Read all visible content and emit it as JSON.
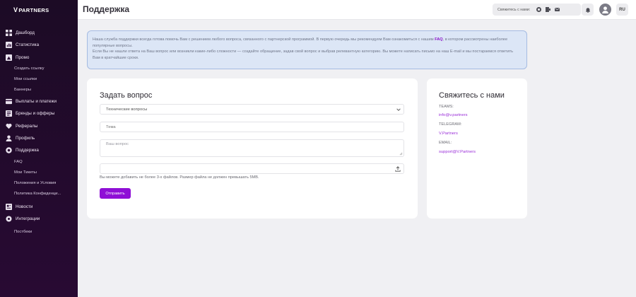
{
  "brand": {
    "logo_mark": "V",
    "logo_text": "PARTNERS",
    "accent_color": "#8f0fd6",
    "sidebar_bg": "#1c0b25"
  },
  "sidebar": {
    "items": [
      {
        "label": "Дашборд",
        "icon": "dashboard-icon"
      },
      {
        "label": "Статистика",
        "icon": "statistics-icon"
      },
      {
        "label": "Промо",
        "icon": "promo-icon"
      },
      {
        "label": "Создать ссылку"
      },
      {
        "label": "Мои ссылки"
      },
      {
        "label": "Баннеры"
      },
      {
        "label": "Выплаты и платежи",
        "icon": "payments-icon"
      },
      {
        "label": "Бренды и офферы",
        "icon": "brands-icon"
      },
      {
        "label": "Рефералы",
        "icon": "referrals-icon"
      },
      {
        "label": "Профиль",
        "icon": "profile-icon"
      },
      {
        "label": "Поддержка",
        "icon": "support-icon"
      },
      {
        "label": "FAQ"
      },
      {
        "label": "Мои Тикеты"
      },
      {
        "label": "Положения и Условия"
      },
      {
        "label": "Политика Конфиденци..."
      },
      {
        "label": "Новости",
        "icon": "news-icon"
      },
      {
        "label": "Интеграции",
        "icon": "integrations-icon"
      },
      {
        "label": "Постбеки"
      }
    ]
  },
  "header": {
    "title": "Поддержка",
    "contact_label": "Свяжитесь с нами:",
    "lang": "RU"
  },
  "info": {
    "line1_pre": "Наша служба поддержки всегда готова помочь Вам с решением любого вопроса, связанного с партнерской программой. В первую очередь мы рекомендуем Вам ознакомиться с нашим ",
    "faq_link": "FAQ",
    "line1_post": ", в котором рассмотрены наиболее популярные вопросы.",
    "line2": "Если Вы не нашли ответа на Ваш вопрос или возникли какие-либо сложности — создайте обращение, задав свой вопрос и выбрав релевантную категорию. Вы можете написать письмо на наш E-mail и мы постараемся ответить Вам в кратчайшие сроки."
  },
  "ask_form": {
    "title": "Задать вопрос",
    "category_selected": "Технические вопросы",
    "subject_placeholder": "Тема",
    "question_placeholder": "Ваш вопрос",
    "file_hint": "Вы можете добавить не более 3-х файлов. Размер файла не должен превышать 5MB.",
    "submit_label": "Отправить"
  },
  "contact": {
    "title": "Свяжитесь с нами",
    "teams_label": "TEAMS:",
    "teams_value": "info@v.partners",
    "telegram_label": "TELEGRAM:",
    "telegram_value": "V.Partners",
    "email_label": "EMAIL:",
    "email_value": "support@V.Partners"
  }
}
